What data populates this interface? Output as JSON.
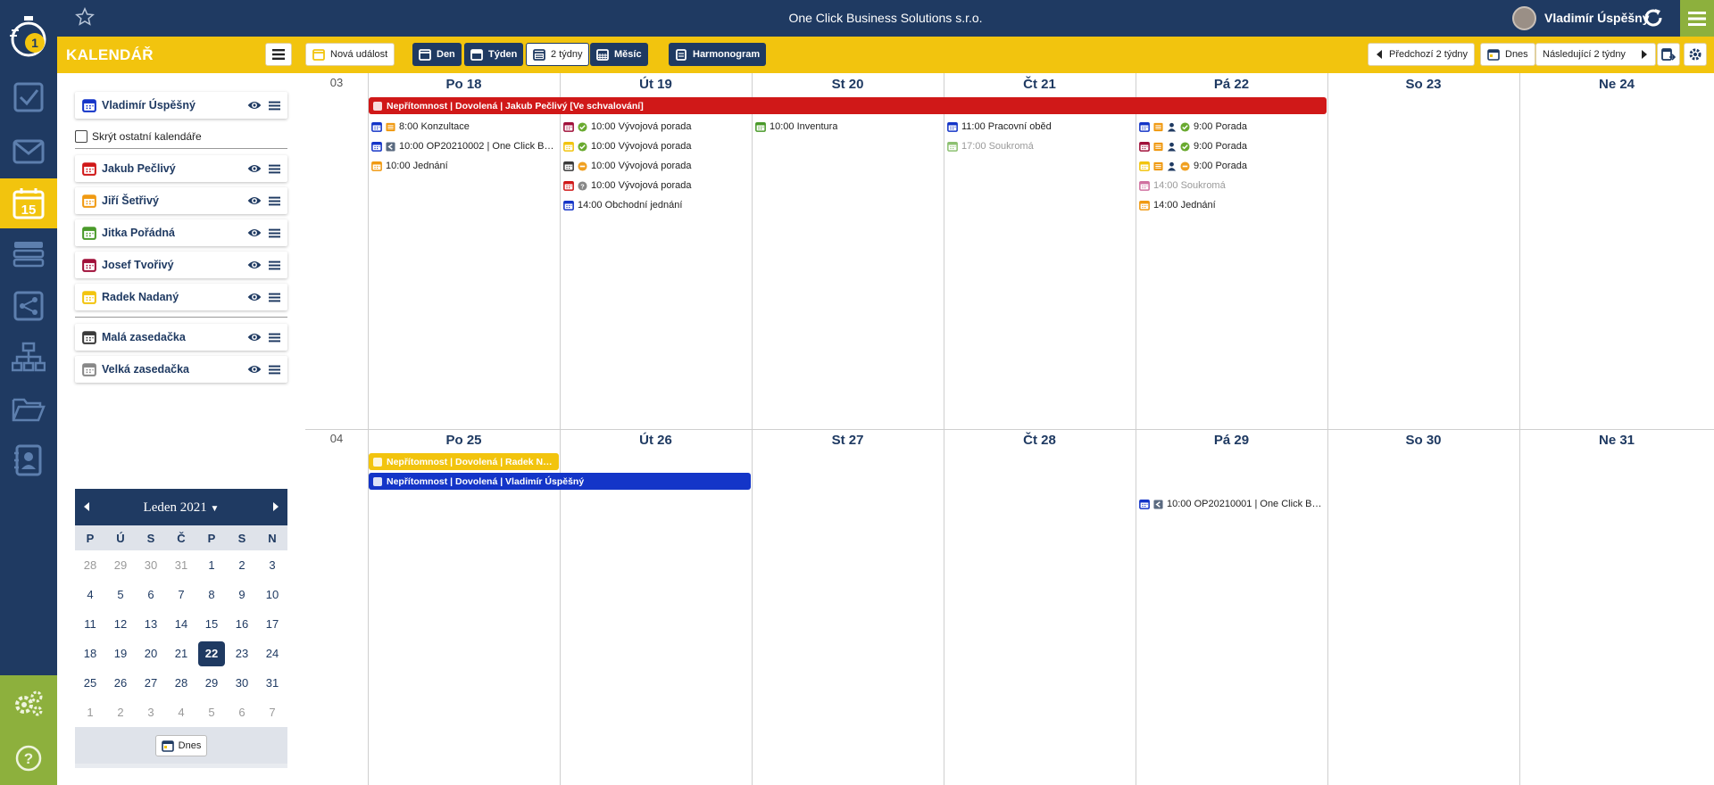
{
  "app": {
    "company": "One Click Business Solutions s.r.o.",
    "user_name": "Vladimír Úspěšný",
    "section_title": "KALENDÁŘ",
    "sidebar_today_number": "15"
  },
  "toolbar": {
    "new_event": "Nová událost",
    "view_day": "Den",
    "view_week": "Týden",
    "view_2weeks": "2 týdny",
    "view_month": "Měsíc",
    "harmonogram": "Harmonogram",
    "prev": "Předchozí 2 týdny",
    "today": "Dnes",
    "next": "Následující 2 týdny"
  },
  "calendars": {
    "own": {
      "label": "Vladimír Úspěšný",
      "color": "#1435c8"
    },
    "hide_others": "Skrýt ostatní kalendáře",
    "people": [
      {
        "label": "Jakub Pečlivý",
        "color": "#d01818"
      },
      {
        "label": "Jiří Šetřivý",
        "color": "#f09a12"
      },
      {
        "label": "Jitka Pořádná",
        "color": "#4a9a2a"
      },
      {
        "label": "Josef Tvořivý",
        "color": "#a0103a"
      },
      {
        "label": "Radek Nadaný",
        "color": "#f2c40e"
      }
    ],
    "rooms": [
      {
        "label": "Malá zasedačka",
        "color": "#3a3a3a"
      },
      {
        "label": "Velká zasedačka",
        "color": "#888888"
      }
    ]
  },
  "mini_calendar": {
    "month": "Leden 2021",
    "day_headers": [
      "P",
      "Ú",
      "S",
      "Č",
      "P",
      "S",
      "N"
    ],
    "days": [
      "28",
      "29",
      "30",
      "31",
      "1",
      "2",
      "3",
      "4",
      "5",
      "6",
      "7",
      "8",
      "9",
      "10",
      "11",
      "12",
      "13",
      "14",
      "15",
      "16",
      "17",
      "18",
      "19",
      "20",
      "21",
      "22",
      "23",
      "24",
      "25",
      "26",
      "27",
      "28",
      "29",
      "30",
      "31",
      "1",
      "2",
      "3",
      "4",
      "5",
      "6",
      "7"
    ],
    "today": "22",
    "today_button": "Dnes"
  },
  "weeks": [
    {
      "number": "03",
      "days": [
        "Po 18",
        "Út 19",
        "St 20",
        "Čt 21",
        "Pá 22",
        "So 23",
        "Ne 24"
      ],
      "bars": [
        {
          "text": "Nepřítomnost | Dovolená | Jakub Pečlivý [Ve schvalování]",
          "color": "#d01818"
        }
      ],
      "events": [
        [
          {
            "time": "8:00",
            "title": "Konzultace",
            "color": "#1435c8",
            "icons": [
              "list-icon"
            ]
          },
          {
            "time": "10:00",
            "title": "OP20210002 | One Click B…",
            "color": "#1435c8",
            "icons": [
              "back-icon"
            ]
          },
          {
            "time": "10:00",
            "title": "Jednání",
            "color": "#f09a12",
            "icons": []
          }
        ],
        [
          {
            "time": "10:00",
            "title": "Vývojová porada",
            "color": "#a0103a",
            "icons": [
              "check-icon"
            ]
          },
          {
            "time": "10:00",
            "title": "Vývojová porada",
            "color": "#f2c40e",
            "icons": [
              "check-icon"
            ]
          },
          {
            "time": "10:00",
            "title": "Vývojová porada",
            "color": "#3a3a3a",
            "icons": [
              "minus-icon"
            ]
          },
          {
            "time": "10:00",
            "title": "Vývojová porada",
            "color": "#d01818",
            "icons": [
              "question-icon"
            ]
          },
          {
            "time": "14:00",
            "title": "Obchodní jednání",
            "color": "#1435c8",
            "icons": []
          }
        ],
        [
          {
            "time": "10:00",
            "title": "Inventura",
            "color": "#4a9a2a",
            "icons": []
          }
        ],
        [
          {
            "time": "11:00",
            "title": "Pracovní oběd",
            "color": "#1435c8",
            "icons": []
          },
          {
            "time": "17:00",
            "title": "Soukromá",
            "color": "#8cc070",
            "icons": [],
            "muted": true
          }
        ],
        [
          {
            "time": "9:00",
            "title": "Porada",
            "color": "#1435c8",
            "icons": [
              "list-icon",
              "person-icon",
              "check-icon"
            ]
          },
          {
            "time": "9:00",
            "title": "Porada",
            "color": "#a0103a",
            "icons": [
              "list-icon",
              "person-icon",
              "check-icon"
            ]
          },
          {
            "time": "9:00",
            "title": "Porada",
            "color": "#f2c40e",
            "icons": [
              "list-icon",
              "person-icon",
              "minus-icon"
            ]
          },
          {
            "time": "14:00",
            "title": "Soukromá",
            "color": "#d070a0",
            "icons": [],
            "muted": true
          },
          {
            "time": "14:00",
            "title": "Jednání",
            "color": "#f09a12",
            "icons": []
          }
        ],
        [],
        []
      ]
    },
    {
      "number": "04",
      "days": [
        "Po 25",
        "Út 26",
        "St 27",
        "Čt 28",
        "Pá 29",
        "So 30",
        "Ne 31"
      ],
      "bars": [
        {
          "text": "Nepřítomnost | Dovolená | Radek N…",
          "color": "#f2c40e"
        },
        {
          "text": "Nepřítomnost | Dovolená | Vladimír Úspěšný",
          "color": "#1435c8"
        }
      ],
      "events": [
        [],
        [],
        [],
        [],
        [
          {
            "time": "10:00",
            "title": "OP20210001 | One Click B…",
            "color": "#1435c8",
            "icons": [
              "back-icon"
            ]
          }
        ],
        [],
        []
      ]
    }
  ]
}
